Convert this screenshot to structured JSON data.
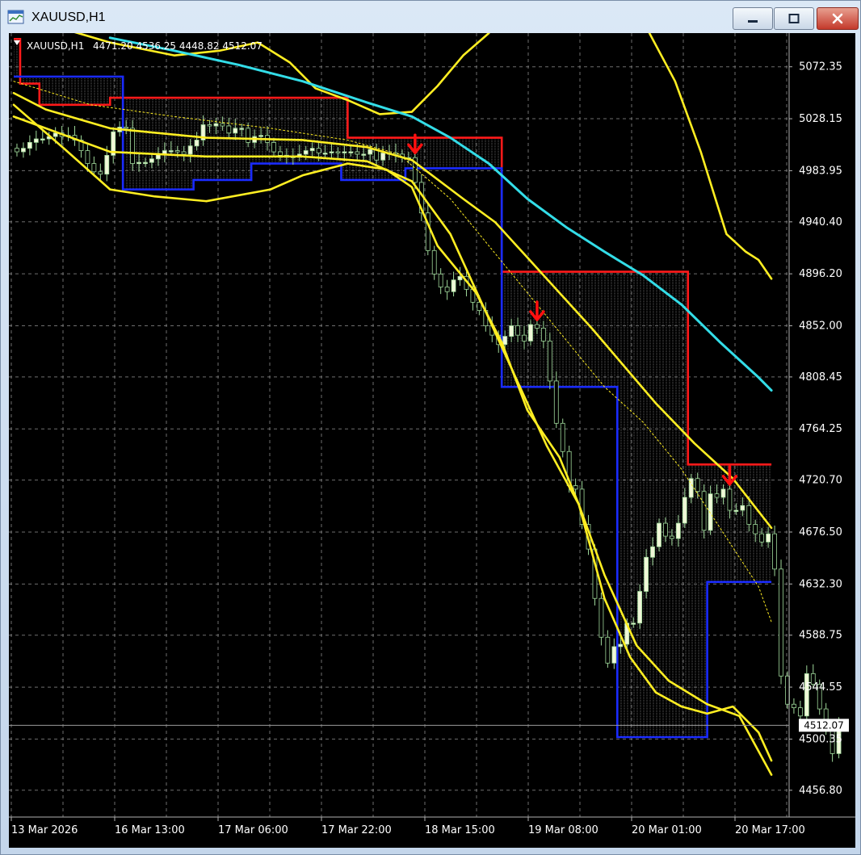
{
  "window": {
    "title": "XAUUSD,H1",
    "icons": {
      "app": "chart-window-icon",
      "minimize": "minimize-icon",
      "maximize": "maximize-icon",
      "close": "close-icon"
    }
  },
  "colors": {
    "background": "#000000",
    "grid": "#8a8a8a",
    "candle_bull": "#f0f8d8",
    "candle_bear": "#000000",
    "candle_outline": "#9fd89a",
    "resistance": "#ff1a1a",
    "support": "#1a2bff",
    "bands": "#ffee22",
    "ma_slow": "#33dde8",
    "arrows": "#ff1010",
    "price_label_bg": "#ffffff"
  },
  "chart_data": {
    "type": "candlestick",
    "symbol_header": "XAUUSD,H1",
    "ohlc_header": "4471.20 4536.25 4448.82 4512.07",
    "current_price": 4512.07,
    "current_price_label": "4512.07",
    "y_ticks": [
      "5072.35",
      "5028.15",
      "4983.95",
      "4940.40",
      "4896.20",
      "4852.00",
      "4808.45",
      "4764.25",
      "4720.70",
      "4676.50",
      "4632.30",
      "4588.75",
      "4544.55",
      "4500.35",
      "4456.80"
    ],
    "x_ticks": [
      "13 Mar 2026",
      "16 Mar 13:00",
      "17 Mar 06:00",
      "17 Mar 22:00",
      "18 Mar 15:00",
      "19 Mar 08:00",
      "20 Mar 01:00",
      "20 Mar 17:00"
    ],
    "ylim": [
      4434.0,
      5101.0
    ],
    "bar_count": 120,
    "grid": true,
    "candles_close": [
      5000,
      5003,
      5008,
      5011,
      5011,
      5013,
      5016,
      5013,
      5014,
      5010,
      5001,
      4990,
      4983,
      4981,
      4997,
      5017,
      5021,
      5020,
      4990,
      4991,
      4991,
      4994,
      4998,
      5001,
      5001,
      5000,
      4998,
      5005,
      5010,
      5023,
      5022,
      5024,
      5022,
      5016,
      5020,
      5020,
      5008,
      5013,
      5014,
      5008,
      5000,
      4997,
      4996,
      4996,
      4998,
      5001,
      5003,
      4999,
      4999,
      5000,
      4999,
      5000,
      5000,
      4998,
      4998,
      5002,
      4993,
      4999,
      4999,
      4998,
      4995,
      4995,
      4974,
      4948,
      4916,
      4896,
      4885,
      4881,
      4891,
      4894,
      4883,
      4872,
      4865,
      4852,
      4844,
      4836,
      4843,
      4852,
      4844,
      4839,
      4853,
      4850,
      4839,
      4805,
      4769,
      4745,
      4716,
      4713,
      4683,
      4662,
      4620,
      4587,
      4565,
      4579,
      4581,
      4599,
      4599,
      4626,
      4655,
      4664,
      4684,
      4673,
      4671,
      4684,
      4706,
      4722,
      4711,
      4678,
      4709,
      4706,
      4713,
      4695,
      4695,
      4699,
      4683,
      4675,
      4668,
      4675,
      4645,
      4554,
      4530,
      4527,
      4520,
      4556,
      4547,
      4526,
      4510,
      4488,
      4512
    ],
    "resistance_levels": [
      {
        "from_bar": 0,
        "to_bar": 1,
        "price": 5096
      },
      {
        "from_bar": 1,
        "to_bar": 4,
        "price": 5058
      },
      {
        "from_bar": 4,
        "to_bar": 8,
        "price": 5040
      },
      {
        "from_bar": 8,
        "to_bar": 15,
        "price": 5040
      },
      {
        "from_bar": 15,
        "to_bar": 52,
        "price": 5046
      },
      {
        "from_bar": 52,
        "to_bar": 59,
        "price": 5012
      },
      {
        "from_bar": 59,
        "to_bar": 76,
        "price": 5012
      },
      {
        "from_bar": 76,
        "to_bar": 78,
        "price": 4898
      },
      {
        "from_bar": 78,
        "to_bar": 105,
        "price": 4898
      },
      {
        "from_bar": 105,
        "to_bar": 118,
        "price": 4734
      }
    ],
    "support_levels": [
      {
        "from_bar": 0,
        "to_bar": 17,
        "price": 5064
      },
      {
        "from_bar": 17,
        "to_bar": 28,
        "price": 4968
      },
      {
        "from_bar": 28,
        "to_bar": 37,
        "price": 4976
      },
      {
        "from_bar": 37,
        "to_bar": 51,
        "price": 4990
      },
      {
        "from_bar": 51,
        "to_bar": 61,
        "price": 4976
      },
      {
        "from_bar": 61,
        "to_bar": 76,
        "price": 4986
      },
      {
        "from_bar": 76,
        "to_bar": 94,
        "price": 4800
      },
      {
        "from_bar": 94,
        "to_bar": 108,
        "price": 4502
      },
      {
        "from_bar": 108,
        "to_bar": 118,
        "price": 4634
      }
    ],
    "band_upper": [
      [
        0,
        5114
      ],
      [
        5,
        5109
      ],
      [
        15,
        5093
      ],
      [
        25,
        5082
      ],
      [
        32,
        5086
      ],
      [
        38,
        5093
      ],
      [
        43,
        5076
      ],
      [
        47,
        5054
      ],
      [
        52,
        5044
      ],
      [
        57,
        5032
      ],
      [
        62,
        5034
      ],
      [
        66,
        5056
      ],
      [
        70,
        5082
      ],
      [
        74,
        5101
      ]
    ],
    "band_middle": [
      [
        0,
        5050
      ],
      [
        5,
        5036
      ],
      [
        15,
        5020
      ],
      [
        30,
        5012
      ],
      [
        45,
        5010
      ],
      [
        55,
        5004
      ],
      [
        62,
        4993
      ],
      [
        70,
        4960
      ],
      [
        75,
        4940
      ],
      [
        80,
        4910
      ],
      [
        85,
        4880
      ],
      [
        90,
        4850
      ],
      [
        95,
        4818
      ],
      [
        100,
        4786
      ],
      [
        106,
        4752
      ],
      [
        112,
        4722
      ],
      [
        118,
        4680
      ]
    ],
    "band_lower": [
      [
        0,
        5040
      ],
      [
        8,
        5002
      ],
      [
        15,
        4968
      ],
      [
        22,
        4962
      ],
      [
        30,
        4958
      ],
      [
        40,
        4968
      ],
      [
        45,
        4980
      ],
      [
        52,
        4990
      ],
      [
        58,
        4985
      ],
      [
        62,
        4970
      ],
      [
        66,
        4920
      ],
      [
        72,
        4880
      ],
      [
        76,
        4838
      ],
      [
        80,
        4780
      ],
      [
        85,
        4740
      ],
      [
        88,
        4700
      ],
      [
        92,
        4620
      ],
      [
        96,
        4570
      ],
      [
        100,
        4540
      ],
      [
        104,
        4528
      ],
      [
        108,
        4522
      ],
      [
        112,
        4528
      ],
      [
        116,
        4506
      ],
      [
        118,
        4482
      ]
    ],
    "band_upper_right": [
      [
        99,
        5101
      ],
      [
        103,
        5060
      ],
      [
        107,
        5000
      ],
      [
        111,
        4930
      ],
      [
        114,
        4915
      ],
      [
        116,
        4908
      ],
      [
        118,
        4892
      ]
    ],
    "band_lower_inner": [
      [
        0,
        5030
      ],
      [
        15,
        5000
      ],
      [
        30,
        4996
      ],
      [
        45,
        4996
      ],
      [
        55,
        4992
      ],
      [
        62,
        4975
      ],
      [
        68,
        4930
      ],
      [
        73,
        4870
      ],
      [
        78,
        4810
      ],
      [
        83,
        4750
      ],
      [
        88,
        4700
      ],
      [
        92,
        4640
      ],
      [
        97,
        4580
      ],
      [
        102,
        4550
      ],
      [
        108,
        4530
      ],
      [
        113,
        4520
      ],
      [
        118,
        4470
      ]
    ],
    "ma_slow": [
      [
        15,
        5097
      ],
      [
        25,
        5086
      ],
      [
        35,
        5074
      ],
      [
        45,
        5060
      ],
      [
        55,
        5042
      ],
      [
        62,
        5030
      ],
      [
        68,
        5012
      ],
      [
        74,
        4990
      ],
      [
        80,
        4960
      ],
      [
        86,
        4936
      ],
      [
        92,
        4915
      ],
      [
        98,
        4895
      ],
      [
        104,
        4870
      ],
      [
        110,
        4838
      ],
      [
        116,
        4808
      ],
      [
        118,
        4797
      ]
    ],
    "ma_dotted": [
      [
        0,
        5060
      ],
      [
        12,
        5040
      ],
      [
        25,
        5030
      ],
      [
        40,
        5020
      ],
      [
        52,
        5010
      ],
      [
        60,
        4998
      ],
      [
        68,
        4960
      ],
      [
        74,
        4920
      ],
      [
        80,
        4880
      ],
      [
        86,
        4840
      ],
      [
        92,
        4800
      ],
      [
        98,
        4770
      ],
      [
        104,
        4730
      ],
      [
        110,
        4680
      ],
      [
        116,
        4630
      ],
      [
        118,
        4600
      ]
    ],
    "sell_arrows_bars": [
      62,
      81,
      111
    ]
  }
}
